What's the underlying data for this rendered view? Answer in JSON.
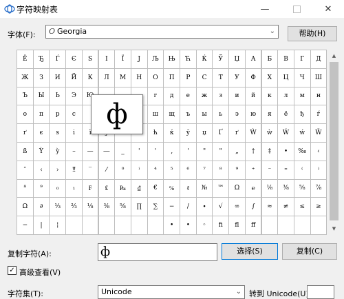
{
  "window": {
    "title": "字符映射表",
    "minimize_glyph": "—",
    "close_glyph": "✕"
  },
  "font": {
    "label": "字体(F):",
    "value": "Georgia",
    "icon_glyph": "O"
  },
  "buttons": {
    "help": "帮助(H)",
    "select": "选择(S)",
    "copy": "复制(C)"
  },
  "grid": {
    "rows": [
      [
        "Ё",
        "Ђ",
        "Ѓ",
        "Є",
        "S",
        "І",
        "Ї",
        "Ј",
        "Љ",
        "Њ",
        "Ћ",
        "Ќ",
        "Ў",
        "Џ",
        "А",
        "Б",
        "В",
        "Г",
        "Д"
      ],
      [
        "Ж",
        "З",
        "И",
        "Й",
        "К",
        "Л",
        "М",
        "Н",
        "О",
        "П",
        "Р",
        "С",
        "Т",
        "У",
        "Ф",
        "Х",
        "Ц",
        "Ч",
        "Ш"
      ],
      [
        "Ъ",
        "Ы",
        "Ь",
        "Э",
        "Ю",
        "",
        "",
        "",
        "г",
        "д",
        "е",
        "ж",
        "з",
        "и",
        "й",
        "к",
        "л",
        "м",
        "н"
      ],
      [
        "о",
        "п",
        "р",
        "с",
        "",
        "",
        "",
        "",
        "ш",
        "щ",
        "ъ",
        "ы",
        "ь",
        "э",
        "ю",
        "я",
        "ё",
        "ђ",
        "ѓ"
      ],
      [
        "ґ",
        "є",
        "ѕ",
        "і",
        "ї",
        "ј",
        "љ",
        "њ",
        "ћ",
        "ќ",
        "ў",
        "џ",
        "Ґ",
        "ґ",
        "Ẁ",
        "ẁ",
        "Ẃ",
        "ẃ",
        "Ẅ"
      ],
      [
        "ß",
        "Ỳ",
        "ỳ",
        "–",
        "—",
        "―",
        "‗",
        "'",
        "'",
        "‚",
        "'",
        "\"",
        "\"",
        "„",
        "†",
        "‡",
        "•",
        "‰",
        "‹"
      ],
      [
        "″",
        "‹",
        "›",
        "‼",
        "‾",
        "⁄",
        "⁰",
        "ⁱ",
        "⁴",
        "⁵",
        "⁶",
        "⁷",
        "⁸",
        "⁹",
        "⁺",
        "⁻",
        "⁼",
        "⁽",
        "⁾"
      ],
      [
        "⁸",
        "⁹",
        "₀",
        "₁",
        "₣",
        "₤",
        "₧",
        "₫",
        "€",
        "℅",
        "ℓ",
        "№",
        "™",
        "Ω",
        "℮",
        "⅛",
        "⅜",
        "⅝",
        "⅞"
      ],
      [
        "Ω",
        "∂",
        "⅓",
        "⅔",
        "⅛",
        "⅜",
        "⅝",
        "∏",
        "∑",
        "−",
        "/",
        "∙",
        "√",
        "∞",
        "∫",
        "≈",
        "≠",
        "≤",
        "≥"
      ],
      [
        "−",
        "|",
        "¦",
        "",
        "",
        "",
        "",
        "",
        "",
        "•",
        "•",
        "◦",
        "fi",
        "fl",
        "ﬀ",
        "",
        "",
        "",
        ""
      ]
    ]
  },
  "selected_char": "ф",
  "copy": {
    "label": "复制字符(A):",
    "value": "ф"
  },
  "advanced": {
    "label": "高级查看(V)",
    "checkmark": "✓"
  },
  "charset": {
    "label": "字符集(T):",
    "value": "Unicode"
  },
  "goto": {
    "label": "转到 Unicode(U):"
  },
  "scrollbar": {
    "up": "▲",
    "down": "▼"
  }
}
